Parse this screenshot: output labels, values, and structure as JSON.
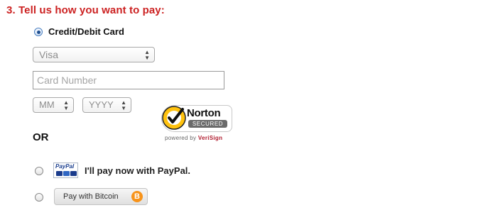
{
  "section": {
    "title": "3. Tell us how you want to pay:"
  },
  "credit": {
    "label": "Credit/Debit Card",
    "selected": true,
    "card_type": {
      "value": "Visa"
    },
    "card_number": {
      "placeholder": "Card Number",
      "value": ""
    },
    "month": {
      "value": "MM"
    },
    "year": {
      "value": "YYYY"
    }
  },
  "norton": {
    "name": "Norton",
    "secured": "SECURED",
    "powered_prefix": "powered by ",
    "powered_brand": "VeriSign",
    "icon": "norton-checkmark-icon"
  },
  "or_label": "OR",
  "paypal": {
    "logo_text": "PayPal",
    "label": "I'll pay now with PayPal.",
    "selected": false
  },
  "bitcoin": {
    "button_label": "Pay with Bitcoin",
    "icon_glyph": "B",
    "icon_color": "#f7931a",
    "selected": false
  },
  "colors": {
    "title": "#cc2222",
    "radio_selected": "#1f4f90",
    "norton_yellow": "#ffc20e",
    "verisign_red": "#b01c2e",
    "paypal_blue": "#1b3f8f"
  }
}
